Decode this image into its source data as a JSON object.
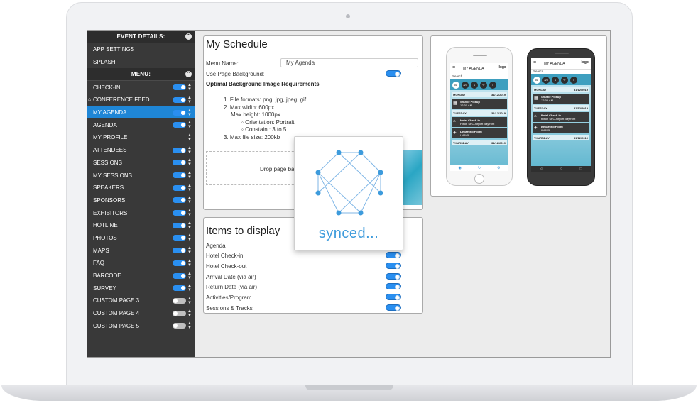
{
  "sidebar": {
    "event_details_header": "EVENT DETAILS:",
    "event_details_items": [
      {
        "label": "APP SETTINGS"
      },
      {
        "label": "SPLASH"
      }
    ],
    "menu_header": "MENU:",
    "menu_items": [
      {
        "label": "CHECK-IN",
        "enabled": true
      },
      {
        "label": "CONFERENCE FEED",
        "enabled": true
      },
      {
        "label": "MY AGENDA",
        "enabled": true,
        "active": true
      },
      {
        "label": "AGENDA",
        "enabled": true
      },
      {
        "label": "MY PROFILE",
        "enabled": null
      },
      {
        "label": "ATTENDEES",
        "enabled": true
      },
      {
        "label": "SESSIONS",
        "enabled": true
      },
      {
        "label": "MY SESSIONS",
        "enabled": true
      },
      {
        "label": "SPEAKERS",
        "enabled": true
      },
      {
        "label": "SPONSORS",
        "enabled": true
      },
      {
        "label": "EXHIBITORS",
        "enabled": true
      },
      {
        "label": "HOTLINE",
        "enabled": true
      },
      {
        "label": "PHOTOS",
        "enabled": true
      },
      {
        "label": "MAPS",
        "enabled": true
      },
      {
        "label": "FAQ",
        "enabled": true
      },
      {
        "label": "BARCODE",
        "enabled": true
      },
      {
        "label": "SURVEY",
        "enabled": true
      },
      {
        "label": "CUSTOM PAGE 3",
        "enabled": false
      },
      {
        "label": "CUSTOM PAGE 4",
        "enabled": false
      },
      {
        "label": "CUSTOM PAGE 5",
        "enabled": false
      }
    ]
  },
  "schedule": {
    "title": "My Schedule",
    "menu_name_label": "Menu Name:",
    "menu_name_value": "My Agenda",
    "use_bg_label": "Use Page Background:",
    "req_prefix": "Optimal",
    "req_link": "Background Image",
    "req_suffix": "Requirements",
    "req_1": "1. File formats: png, jpg, jpeg, gif",
    "req_2": "2. Max width: 600px",
    "req_2b": "Max height: 1000px",
    "req_2c": "Orientation: Portrait",
    "req_2d": "Constaint: 3 to 5",
    "req_3": "3. Max file size: 200kb",
    "drop_text": "Drop page back"
  },
  "items_panel": {
    "title": "Items to display",
    "section": "Agenda",
    "items": [
      {
        "label": "Hotel Check-in",
        "enabled": true
      },
      {
        "label": "Hotel Check-out",
        "enabled": true
      },
      {
        "label": "Arrival Date (via air)",
        "enabled": true
      },
      {
        "label": "Return Date (via air)",
        "enabled": true
      },
      {
        "label": "Activities/Program",
        "enabled": true
      },
      {
        "label": "Sessions & Tracks",
        "enabled": true
      }
    ]
  },
  "sync": {
    "text": "synced..."
  },
  "phone": {
    "title": "MY AGENDA",
    "logo": "logo",
    "search": "Search",
    "chips": [
      "All",
      "3/3",
      "1"
    ],
    "day1": "MONDAY",
    "day1_date": "31/12/2019",
    "card1_title": "Shuttle Pickup",
    "card1_sub": "12:30 AM",
    "day2": "TUESDAY",
    "day2_date": "31/12/2019",
    "card2_title": "Hotel Check-in",
    "card2_sub": "Hilton SFO Airport Bayfront",
    "card3_title": "Departing Flight",
    "card3_sub": "UA845",
    "day3": "THURSDAY",
    "day3_date": "31/12/2019"
  },
  "colors": {
    "accent": "#1f86d6",
    "sidebar_bg": "#393939",
    "sync_text": "#3d9bdc"
  }
}
